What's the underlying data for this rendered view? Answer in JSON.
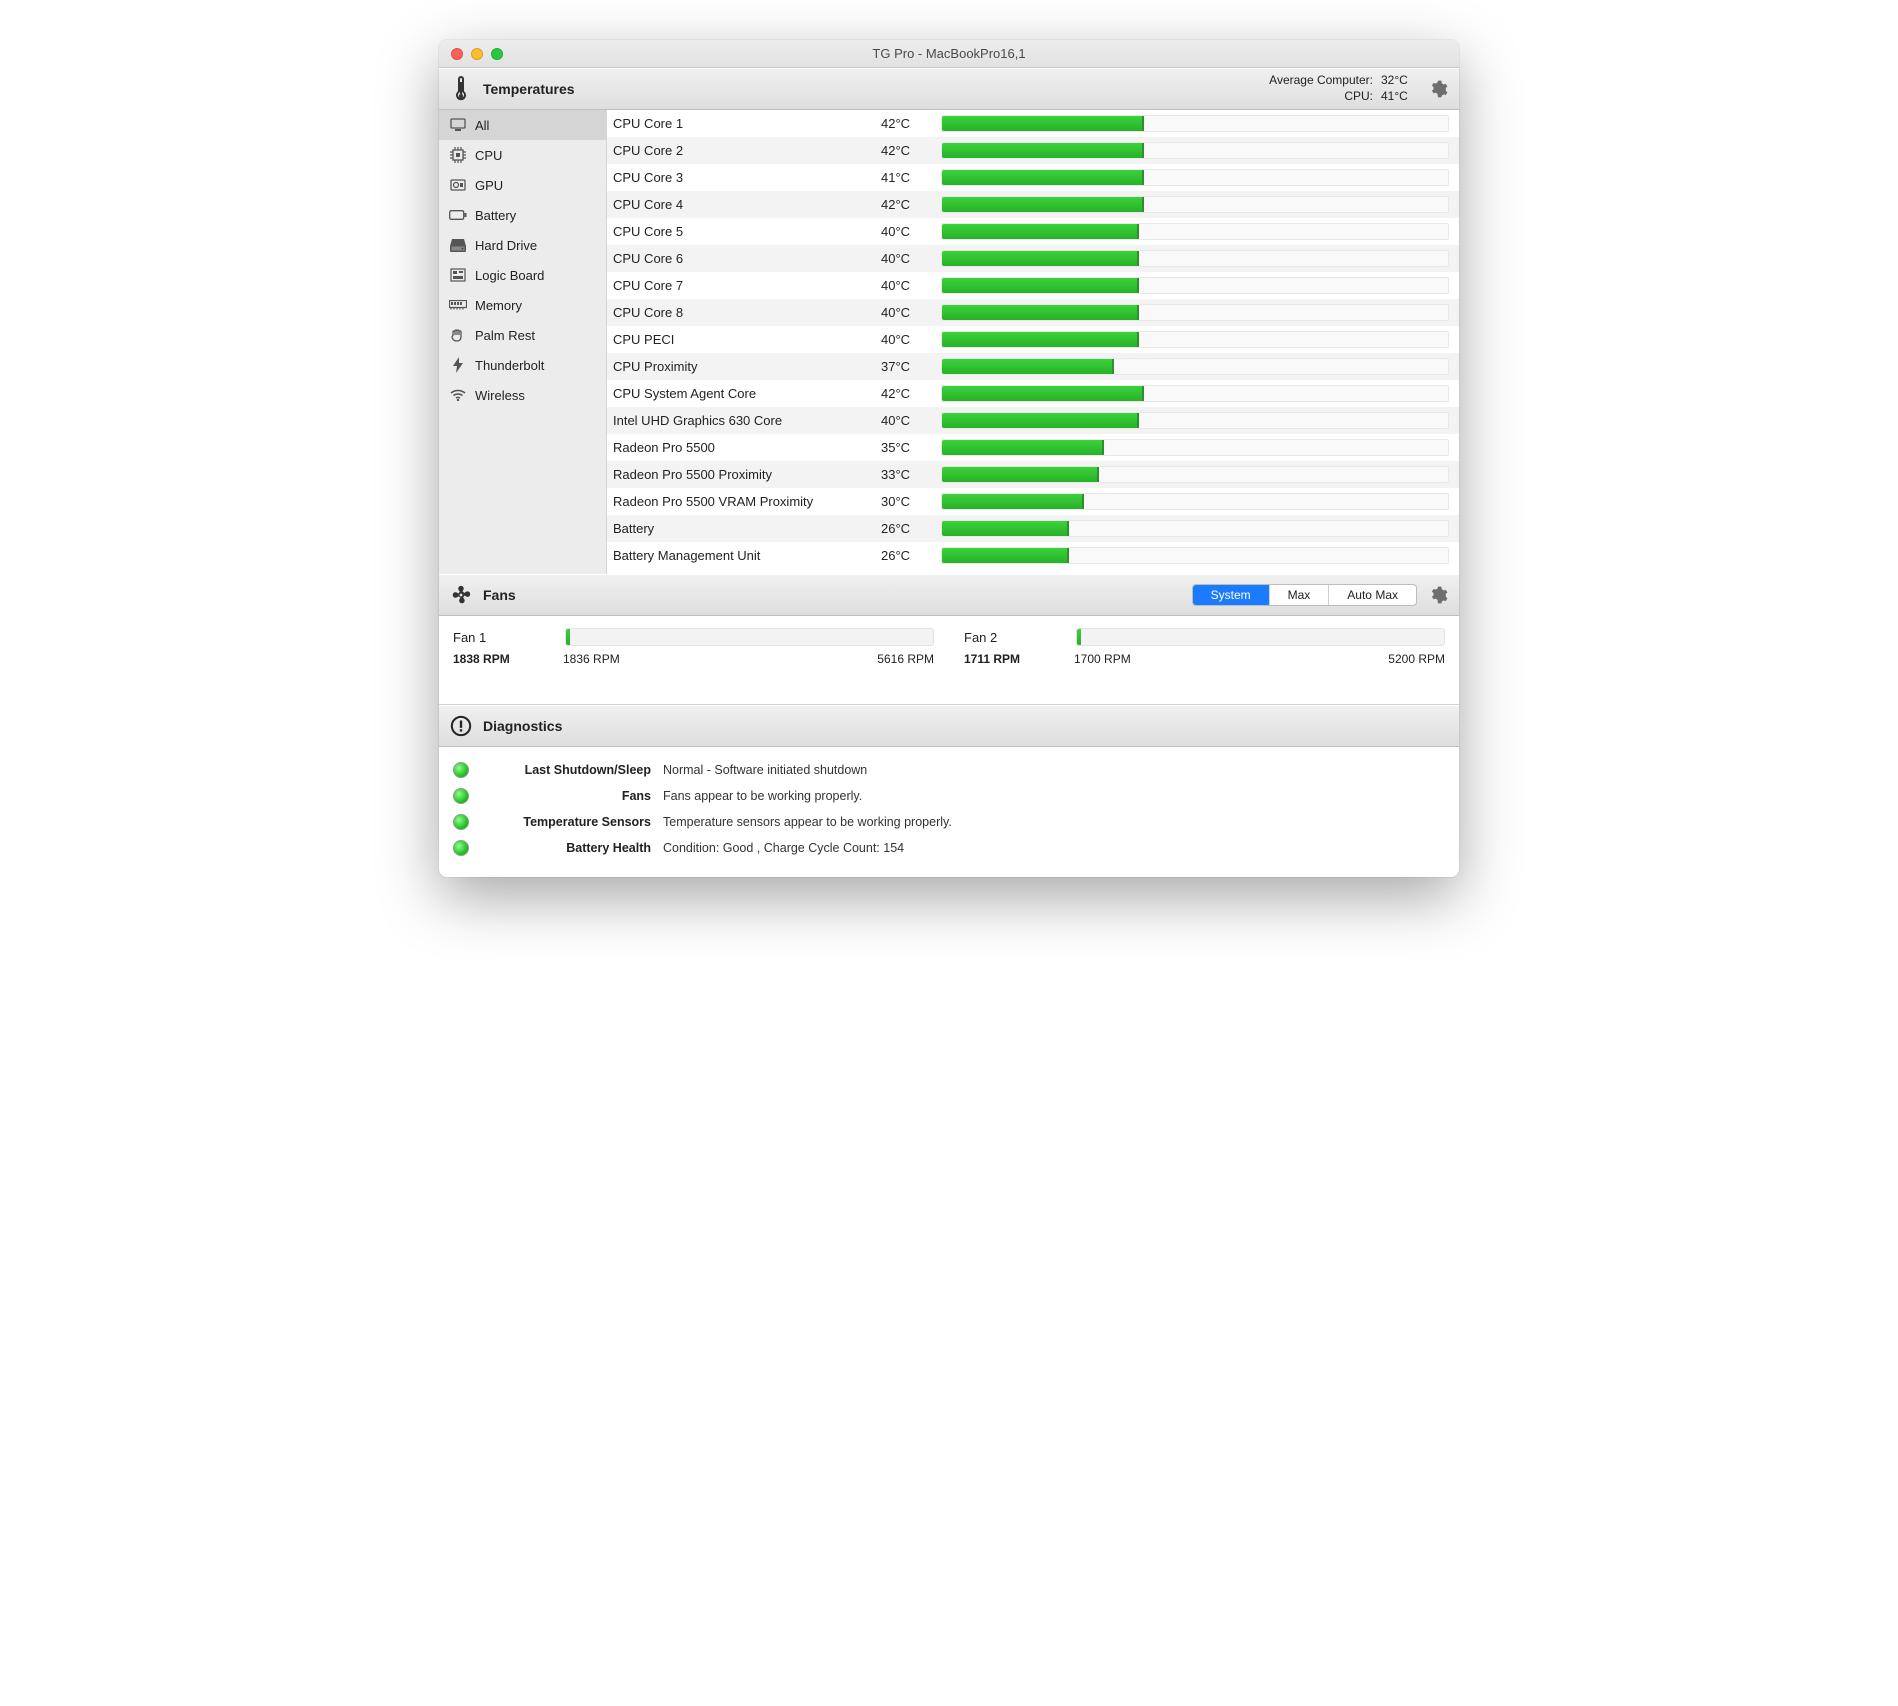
{
  "window": {
    "title": "TG Pro - MacBookPro16,1"
  },
  "temperatures": {
    "section_label": "Temperatures",
    "avg_computer_label": "Average Computer:",
    "avg_computer_value": "32°C",
    "avg_cpu_label": "CPU:",
    "avg_cpu_value": "41°C",
    "sidebar": [
      {
        "icon": "monitor",
        "label": "All",
        "selected": true
      },
      {
        "icon": "cpu",
        "label": "CPU"
      },
      {
        "icon": "gpu",
        "label": "GPU"
      },
      {
        "icon": "battery",
        "label": "Battery"
      },
      {
        "icon": "hdd",
        "label": "Hard Drive"
      },
      {
        "icon": "board",
        "label": "Logic Board"
      },
      {
        "icon": "memory",
        "label": "Memory"
      },
      {
        "icon": "palm",
        "label": "Palm Rest"
      },
      {
        "icon": "bolt",
        "label": "Thunderbolt"
      },
      {
        "icon": "wifi",
        "label": "Wireless"
      }
    ],
    "rows": [
      {
        "name": "CPU Core 1",
        "value": "42°C",
        "pct": 40
      },
      {
        "name": "CPU Core 2",
        "value": "42°C",
        "pct": 40
      },
      {
        "name": "CPU Core 3",
        "value": "41°C",
        "pct": 40
      },
      {
        "name": "CPU Core 4",
        "value": "42°C",
        "pct": 40
      },
      {
        "name": "CPU Core 5",
        "value": "40°C",
        "pct": 39
      },
      {
        "name": "CPU Core 6",
        "value": "40°C",
        "pct": 39
      },
      {
        "name": "CPU Core 7",
        "value": "40°C",
        "pct": 39
      },
      {
        "name": "CPU Core 8",
        "value": "40°C",
        "pct": 39
      },
      {
        "name": "CPU PECI",
        "value": "40°C",
        "pct": 39
      },
      {
        "name": "CPU Proximity",
        "value": "37°C",
        "pct": 34
      },
      {
        "name": "CPU System Agent Core",
        "value": "42°C",
        "pct": 40
      },
      {
        "name": "Intel UHD Graphics 630 Core",
        "value": "40°C",
        "pct": 39
      },
      {
        "name": "Radeon Pro 5500",
        "value": "35°C",
        "pct": 32
      },
      {
        "name": "Radeon Pro 5500 Proximity",
        "value": "33°C",
        "pct": 31
      },
      {
        "name": "Radeon Pro 5500 VRAM Proximity",
        "value": "30°C",
        "pct": 28
      },
      {
        "name": "Battery",
        "value": "26°C",
        "pct": 25
      },
      {
        "name": "Battery Management Unit",
        "value": "26°C",
        "pct": 25
      }
    ]
  },
  "fans": {
    "section_label": "Fans",
    "segments": [
      "System",
      "Max",
      "Auto Max"
    ],
    "segment_active": 0,
    "items": [
      {
        "name": "Fan 1",
        "current": "1838 RPM",
        "min": "1836 RPM",
        "max": "5616 RPM",
        "pct": 1
      },
      {
        "name": "Fan 2",
        "current": "1711 RPM",
        "min": "1700 RPM",
        "max": "5200 RPM",
        "pct": 1
      }
    ]
  },
  "diagnostics": {
    "section_label": "Diagnostics",
    "rows": [
      {
        "label": "Last Shutdown/Sleep",
        "desc": "Normal - Software initiated shutdown"
      },
      {
        "label": "Fans",
        "desc": "Fans appear to be working properly."
      },
      {
        "label": "Temperature Sensors",
        "desc": "Temperature sensors appear to be working properly."
      },
      {
        "label": "Battery Health",
        "desc": "Condition: Good , Charge Cycle Count: 154"
      }
    ]
  }
}
